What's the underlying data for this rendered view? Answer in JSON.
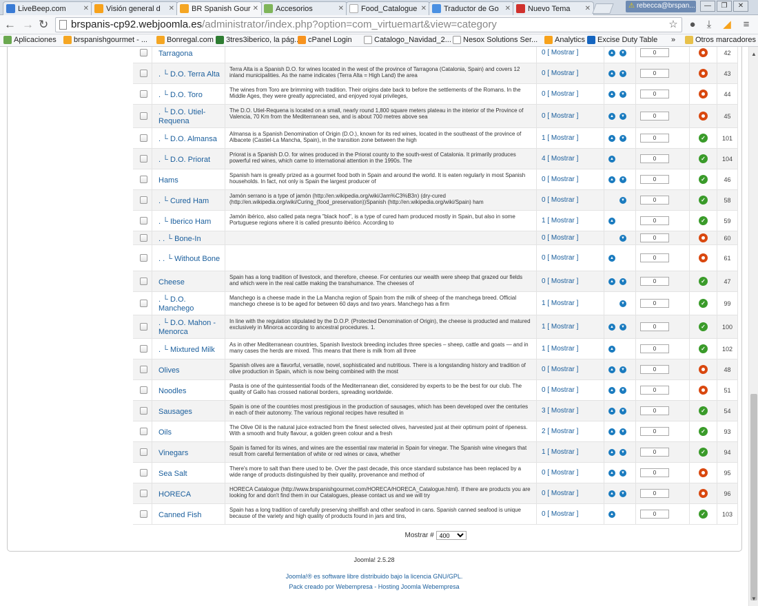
{
  "browser": {
    "tabs": [
      {
        "title": "LiveBeep.com",
        "color": "#3a7bd5"
      },
      {
        "title": "Visión general d",
        "color": "#f7a21b"
      },
      {
        "title": "BR Spanish Gour",
        "color": "#f5a623"
      },
      {
        "title": "Accesorios",
        "color": "#7fb55a"
      },
      {
        "title": "Food_Catalogue",
        "color": "#ffffff"
      },
      {
        "title": "Traductor de Go",
        "color": "#4a90e2"
      },
      {
        "title": "Nuevo Tema",
        "color": "#d0312d"
      }
    ],
    "profile": "rebecca@brspan...",
    "warning_symbol": "⚠",
    "url_host": "brspanis-cp92.webjoomla.es",
    "url_path": "/administrator/index.php?option=com_virtuemart&view=category",
    "bookmarks": [
      {
        "label": "Aplicaciones",
        "color": "#6aa84f"
      },
      {
        "label": "brspanishgourmet - ...",
        "color": "#f5a623"
      },
      {
        "label": "Bonregal.com",
        "color": "#f5a623"
      },
      {
        "label": "3tres3iberico, la pág...",
        "color": "#2e7d32"
      },
      {
        "label": "cPanel Login",
        "color": "#f7931e"
      },
      {
        "label": "Catalogo_Navidad_2...",
        "color": "#ffffff"
      },
      {
        "label": "Nesox Solutions Ser...",
        "color": "#ffffff"
      },
      {
        "label": "Analytics",
        "color": "#f7a21b"
      },
      {
        "label": "Excise Duty Table",
        "color": "#1565c0"
      },
      {
        "label": "»",
        "color": ""
      },
      {
        "label": "Otros marcadores",
        "color": "#e8c14a"
      }
    ]
  },
  "grid": {
    "publish_label": "[ Mostrar ]",
    "ordering_value": "0",
    "rows": [
      {
        "name": "Tarragona",
        "desc": "",
        "count": "0",
        "order": "both",
        "published": false,
        "id": "42"
      },
      {
        "name": ". └ D.O. Terra Alta",
        "desc": "Terra Alta is a Spanish D.O. for wines located in the west of the province of Tarragona (Catalonia, Spain) and covers 12 inland municipalities. As the name indicates (Terra Alta = High Land) the area",
        "count": "0",
        "order": "both",
        "published": false,
        "id": "43"
      },
      {
        "name": ". └ D.O. Toro",
        "desc": "The wines from Toro are brimming with tradition. Their origins date back to before the settlements of the Romans. In the Middle Ages, they were greatly appreciated, and enjoyed royal privileges,",
        "count": "0",
        "order": "both",
        "published": false,
        "id": "44"
      },
      {
        "name": ". └ D.O. Utiel-Requena",
        "desc": "The D.O. Utiel-Requena is located on a small, nearly round 1,800 square meters plateau in the interior of the Province of Valencia, 70 Km from the Mediterranean sea, and is about 700 metres above sea",
        "count": "0",
        "order": "both",
        "published": false,
        "id": "45"
      },
      {
        "name": ". └ D.O. Almansa",
        "desc": "Almansa is a Spanish Denomination of Origin (D.O.), known for its red wines, located in the southeast of the province of Albacete (Castiel-La Mancha, Spain), in the transition zone between the high",
        "count": "1",
        "order": "both",
        "published": true,
        "id": "101"
      },
      {
        "name": ". └ D.O. Priorat",
        "desc": "Priorat is a Spanish D.O. for wines produced in the Priorat county to the south-west of Catalonia. It primarily produces powerful red wines, which came to international attention in the 1990s. The",
        "count": "4",
        "order": "up",
        "published": true,
        "id": "104"
      },
      {
        "name": "Hams",
        "desc": "Spanish ham is greatly prized as a gourmet food both in Spain and around the world. It is eaten regularly in most Spanish households. In fact, not only is Spain the largest producer of",
        "count": "0",
        "order": "both",
        "published": true,
        "id": "46"
      },
      {
        "name": ". └ Cured Ham",
        "desc": "Jamón serrano is a type of jamón (http://en.wikipedia.org/wiki/Jam%C3%B3n) (dry-cured (http://en.wikipedia.org/wiki/Curing_(food_preservation))Spanish (http://en.wikipedia.org/wiki/Spain) ham",
        "count": "0",
        "order": "down",
        "published": true,
        "id": "58"
      },
      {
        "name": ". └ Iberico Ham",
        "desc": "Jamón ibérico, also called pata negra \"black hoof\", is a type of cured ham produced mostly in Spain, but also in some Portuguese regions where it is called presunto ibérico. According to",
        "count": "1",
        "order": "up",
        "published": true,
        "id": "59"
      },
      {
        "name": ". . └ Bone-In",
        "desc": "",
        "count": "0",
        "order": "down",
        "published": false,
        "id": "60"
      },
      {
        "name": ". . └ Without Bone",
        "desc": "",
        "count": "0",
        "order": "up",
        "published": false,
        "id": "61"
      },
      {
        "name": "Cheese",
        "desc": "Spain has a long tradition of livestock, and therefore, cheese. For centuries our wealth were sheep that grazed our fields and which were in the real cattle making the transhumance. The cheeses of",
        "count": "0",
        "order": "both",
        "published": true,
        "id": "47"
      },
      {
        "name": ". └ D.O. Manchego",
        "desc": "Manchego is a cheese made in the La Mancha region of Spain from the milk of sheep of the manchega breed. Official manchego cheese is to be aged for between 60 days and two years. Manchego has a firm",
        "count": "1",
        "order": "down",
        "published": true,
        "id": "99"
      },
      {
        "name": ". └ D.O. Mahon - Menorca",
        "desc": "In line with the regulation stipulated by the D.O.P. (Protected Denomination of Origin), the cheese is producted and matured exclusively in Minorca according to ancestral procedures. 1.",
        "count": "1",
        "order": "both",
        "published": true,
        "id": "100"
      },
      {
        "name": ". └ Mixtured Milk",
        "desc": "As in other Mediterranean countries, Spanish livestock breeding includes three species – sheep, cattle and goats — and in many cases the herds are mixed. This means that there is milk from all three",
        "count": "1",
        "order": "up",
        "published": true,
        "id": "102"
      },
      {
        "name": "Olives",
        "desc": "Spanish olives are a flavorful, versatile, novel, sophisticated and nutritious. There is a longstanding history and tradition of olive production in Spain, which is now being combined with the most",
        "count": "0",
        "order": "both",
        "published": false,
        "id": "48"
      },
      {
        "name": "Noodles",
        "desc": "Pasta is one of the quintessential foods of the Mediterranean diet, considered by experts to be the best for our club. The quality of Gallo has crossed national borders, spreading worldwide.",
        "count": "0",
        "order": "both",
        "published": false,
        "id": "51"
      },
      {
        "name": "Sausages",
        "desc": "Spain is one of the countries most prestigious in the production of sausages, which has been developed over the centuries in each of their autonomy. The various regional recipes have resulted in",
        "count": "3",
        "order": "both",
        "published": true,
        "id": "54"
      },
      {
        "name": "Oils",
        "desc": "The Olive Oil is the natural juice extracted from the finest selected olives, harvested just at their optimum point of ripeness. With a smooth and fruity flavour, a golden green colour and a fresh",
        "count": "2",
        "order": "both",
        "published": true,
        "id": "93"
      },
      {
        "name": "Vinegars",
        "desc": "Spain is famed for its wines, and wines are the essential raw material in Spain for vinegar. The Spanish wine vinegars that result from careful fermentation of white or red wines or cava, whether",
        "count": "1",
        "order": "both",
        "published": true,
        "id": "94"
      },
      {
        "name": "Sea Salt",
        "desc": "There's more to salt than there used to be. Over the past decade, this once standard substance has been replaced by a wide range of products distinguished by their quality, provenance and method of",
        "count": "0",
        "order": "both",
        "published": false,
        "id": "95"
      },
      {
        "name": "HORECA",
        "desc": "HORECA Catalogue (http://www.brspanishgourmet.com/HORECA/HORECA_Catalogue.html). If there are products you are looking for and don't find them in our Catalogues, please contact us and we will try",
        "count": "0",
        "order": "both",
        "published": false,
        "id": "96"
      },
      {
        "name": "Canned Fish",
        "desc": "Spain has a long tradition of carefully preserving shellfish and other seafood in cans. Spanish canned seafood is unique because of the variety and high quality of products found in jars and tins,",
        "count": "0",
        "order": "up",
        "published": true,
        "id": "103"
      }
    ]
  },
  "pager": {
    "label": "Mostrar #",
    "value": "400"
  },
  "footer": {
    "version": "Joomla! 2.5.28",
    "license": "Joomla!® es software libre distribuido bajo la licencia GNU/GPL.",
    "credits": "Pack creado por Webempresa - Hosting Joomla Webempresa"
  },
  "colors": {
    "link": "#1a5e9c",
    "published": "#3a9b2a",
    "unpublished": "#d9480f",
    "order_arrow": "#1a7bbf"
  }
}
